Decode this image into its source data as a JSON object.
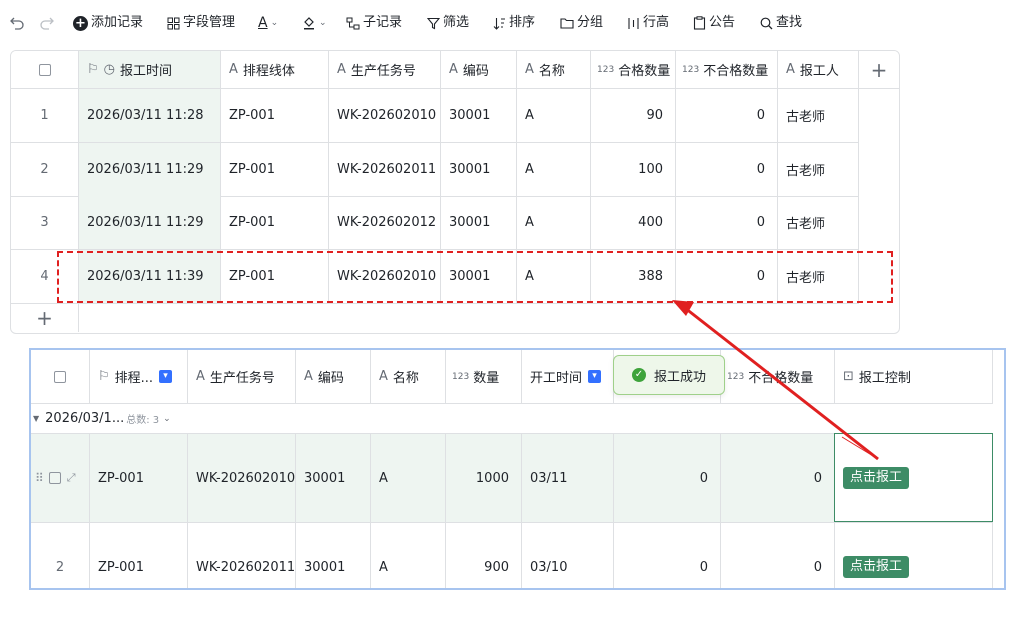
{
  "toolbar": {
    "add_record": "添加记录",
    "field_manage": "字段管理",
    "text_color": "A",
    "sub_record": "子记录",
    "filter": "筛选",
    "sort": "排序",
    "group": "分组",
    "row_height": "行高",
    "announcement": "公告",
    "search": "查找"
  },
  "top_table": {
    "columns": [
      "报工时间",
      "排程线体",
      "生产任务号",
      "编码",
      "名称",
      "合格数量",
      "不合格数量",
      "报工人"
    ],
    "column_types": [
      "time",
      "A",
      "A",
      "A",
      "A",
      "123",
      "123",
      "A"
    ],
    "rows": [
      {
        "index": "1",
        "time": "2026/03/11 11:28",
        "line": "ZP-001",
        "task": "WK-202602010",
        "code": "30001",
        "name": "A",
        "qualified": "90",
        "unqualified": "0",
        "reporter": "古老师"
      },
      {
        "index": "2",
        "time": "2026/03/11 11:29",
        "line": "ZP-001",
        "task": "WK-202602011",
        "code": "30001",
        "name": "A",
        "qualified": "100",
        "unqualified": "0",
        "reporter": "古老师"
      },
      {
        "index": "3",
        "time": "2026/03/11 11:29",
        "line": "ZP-001",
        "task": "WK-202602012",
        "code": "30001",
        "name": "A",
        "qualified": "400",
        "unqualified": "0",
        "reporter": "古老师"
      },
      {
        "index": "4",
        "time": "2026/03/11 11:39",
        "line": "ZP-001",
        "task": "WK-202602010",
        "code": "30001",
        "name": "A",
        "qualified": "388",
        "unqualified": "0",
        "reporter": "古老师"
      }
    ]
  },
  "bottom_table": {
    "columns": [
      "排程...",
      "生产任务号",
      "编码",
      "名称",
      "数量",
      "开工时间",
      "不合格数量",
      "报工控制"
    ],
    "group_label": "2026/03/1...",
    "group_count_label": "总数: 3",
    "rows": [
      {
        "index": "",
        "line": "ZP-001",
        "task": "WK-202602010",
        "code": "30001",
        "name": "A",
        "qty": "1000",
        "start": "03/11",
        "qualified": "0",
        "unqualified": "0",
        "action": "点击报工"
      },
      {
        "index": "2",
        "line": "ZP-001",
        "task": "WK-202602011",
        "code": "30001",
        "name": "A",
        "qty": "900",
        "start": "03/10",
        "qualified": "0",
        "unqualified": "0",
        "action": "点击报工"
      }
    ]
  },
  "toast": {
    "message": "报工成功"
  },
  "colors": {
    "accent_green": "#3d8c66",
    "highlight_red": "#e02020",
    "selection_blue": "#a7c4ef"
  }
}
